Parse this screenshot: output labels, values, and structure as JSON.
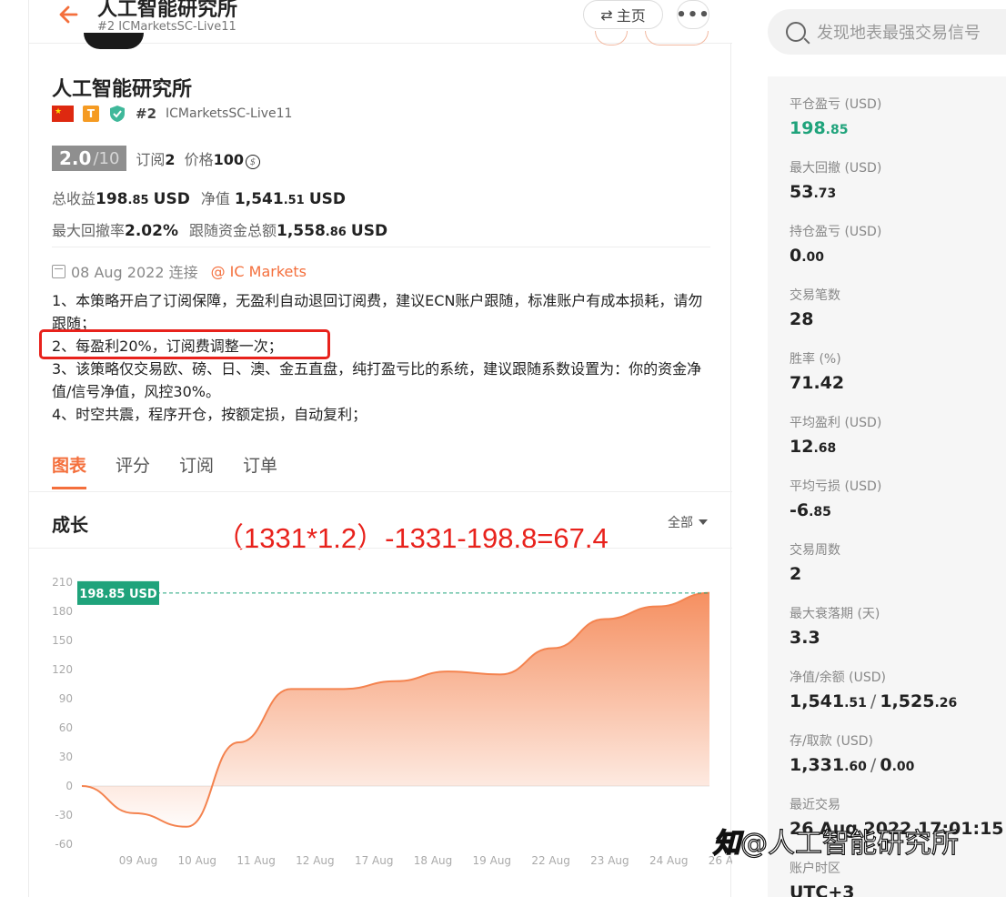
{
  "header": {
    "title": "人工智能研究所",
    "subtitle": "#2 ICMarketsSC-Live11",
    "home_label": "主页",
    "home_icon": "swap-icon",
    "more_icon": "more-icon"
  },
  "profile": {
    "name": "人工智能研究所",
    "rank": "#2",
    "account": "ICMarketsSC-Live11",
    "t_badge": "T",
    "score": "2.0",
    "score_den": "/10",
    "subscribe_label": "订阅",
    "subscribe_count": "2",
    "price_label": "价格",
    "price_value": "100",
    "total_profit_label": "总收益",
    "total_profit_int": "198",
    "total_profit_dec": ".85",
    "total_profit_unit": "USD",
    "equity_label": "净值",
    "equity_int": "1,541",
    "equity_dec": ".51",
    "equity_unit": "USD",
    "max_dd_label": "最大回撤率",
    "max_dd_value": "2.02%",
    "follow_total_label": "跟随资金总额",
    "follow_total_int": "1,558",
    "follow_total_dec": ".86",
    "follow_total_unit": "USD",
    "connect_date": "08 Aug 2022 连接",
    "broker": "@ IC Markets"
  },
  "description": [
    "1、本策略开启了订阅保障，无盈利自动退回订阅费，建议ECN账户跟随，标准账户有成本损耗，请勿跟随；",
    "2、每盈利20%，订阅费调整一次；",
    "3、该策略仅交易欧、磅、日、澳、金五直盘，纯打盈亏比的系统，建议跟随系数设置为：你的资金净值/信号净值，风控30%。",
    "4、时空共震，程序开仓，按额定损，自动复利；"
  ],
  "tabs": [
    "图表",
    "评分",
    "订阅",
    "订单"
  ],
  "growth": {
    "title": "成长",
    "annotation": "（1331*1.2）-1331-198.8=67.4",
    "range_label": "全部"
  },
  "chart_data": {
    "type": "area",
    "x": [
      "09 Aug",
      "10 Aug",
      "11 Aug",
      "12 Aug",
      "17 Aug",
      "18 Aug",
      "19 Aug",
      "22 Aug",
      "23 Aug",
      "24 Aug",
      "26 Aug"
    ],
    "series": [
      {
        "values": [
          0,
          -28,
          -42,
          45,
          100,
          100,
          108,
          118,
          115,
          142,
          172,
          185,
          199
        ]
      }
    ],
    "yticks": [
      210,
      180,
      150,
      120,
      90,
      60,
      30,
      0,
      -30,
      -60
    ],
    "ylim": [
      -60,
      210
    ],
    "current_label": "198.85 USD",
    "current_value": 198.85,
    "color": "#f4834f",
    "label_color": "#1fa37b"
  },
  "search": {
    "placeholder": "发现地表最强交易信号"
  },
  "metrics": [
    {
      "label": "平仓盈亏 (USD)",
      "int": "198",
      "dec": ".85",
      "green": true
    },
    {
      "label": "最大回撤 (USD)",
      "int": "53",
      "dec": ".73"
    },
    {
      "label": "持仓盈亏 (USD)",
      "int": "0",
      "dec": ".00"
    },
    {
      "label": "交易笔数",
      "int": "28",
      "dec": ""
    },
    {
      "label": "胜率 (%)",
      "int": "71.42",
      "dec": ""
    },
    {
      "label": "平均盈利 (USD)",
      "int": "12",
      "dec": ".68"
    },
    {
      "label": "平均亏损 (USD)",
      "int": "-6",
      "dec": ".85"
    },
    {
      "label": "交易周数",
      "int": "2",
      "dec": ""
    },
    {
      "label": "最大衰落期 (天)",
      "int": "3.3",
      "dec": ""
    },
    {
      "label": "净值/余额 (USD)",
      "int": "1,541",
      "dec": ".51",
      "int2": "1,525",
      "dec2": ".26"
    },
    {
      "label": "存/取款 (USD)",
      "int": "1,331",
      "dec": ".60",
      "int2": "0",
      "dec2": ".00"
    },
    {
      "label": "最近交易",
      "int": "26 Aug 2022 17:01:15",
      "dec": ""
    },
    {
      "label": "账户时区",
      "int": "UTC+3",
      "dec": ""
    }
  ],
  "watermark": {
    "logo": "知",
    "text": "@人工智能研究所"
  }
}
